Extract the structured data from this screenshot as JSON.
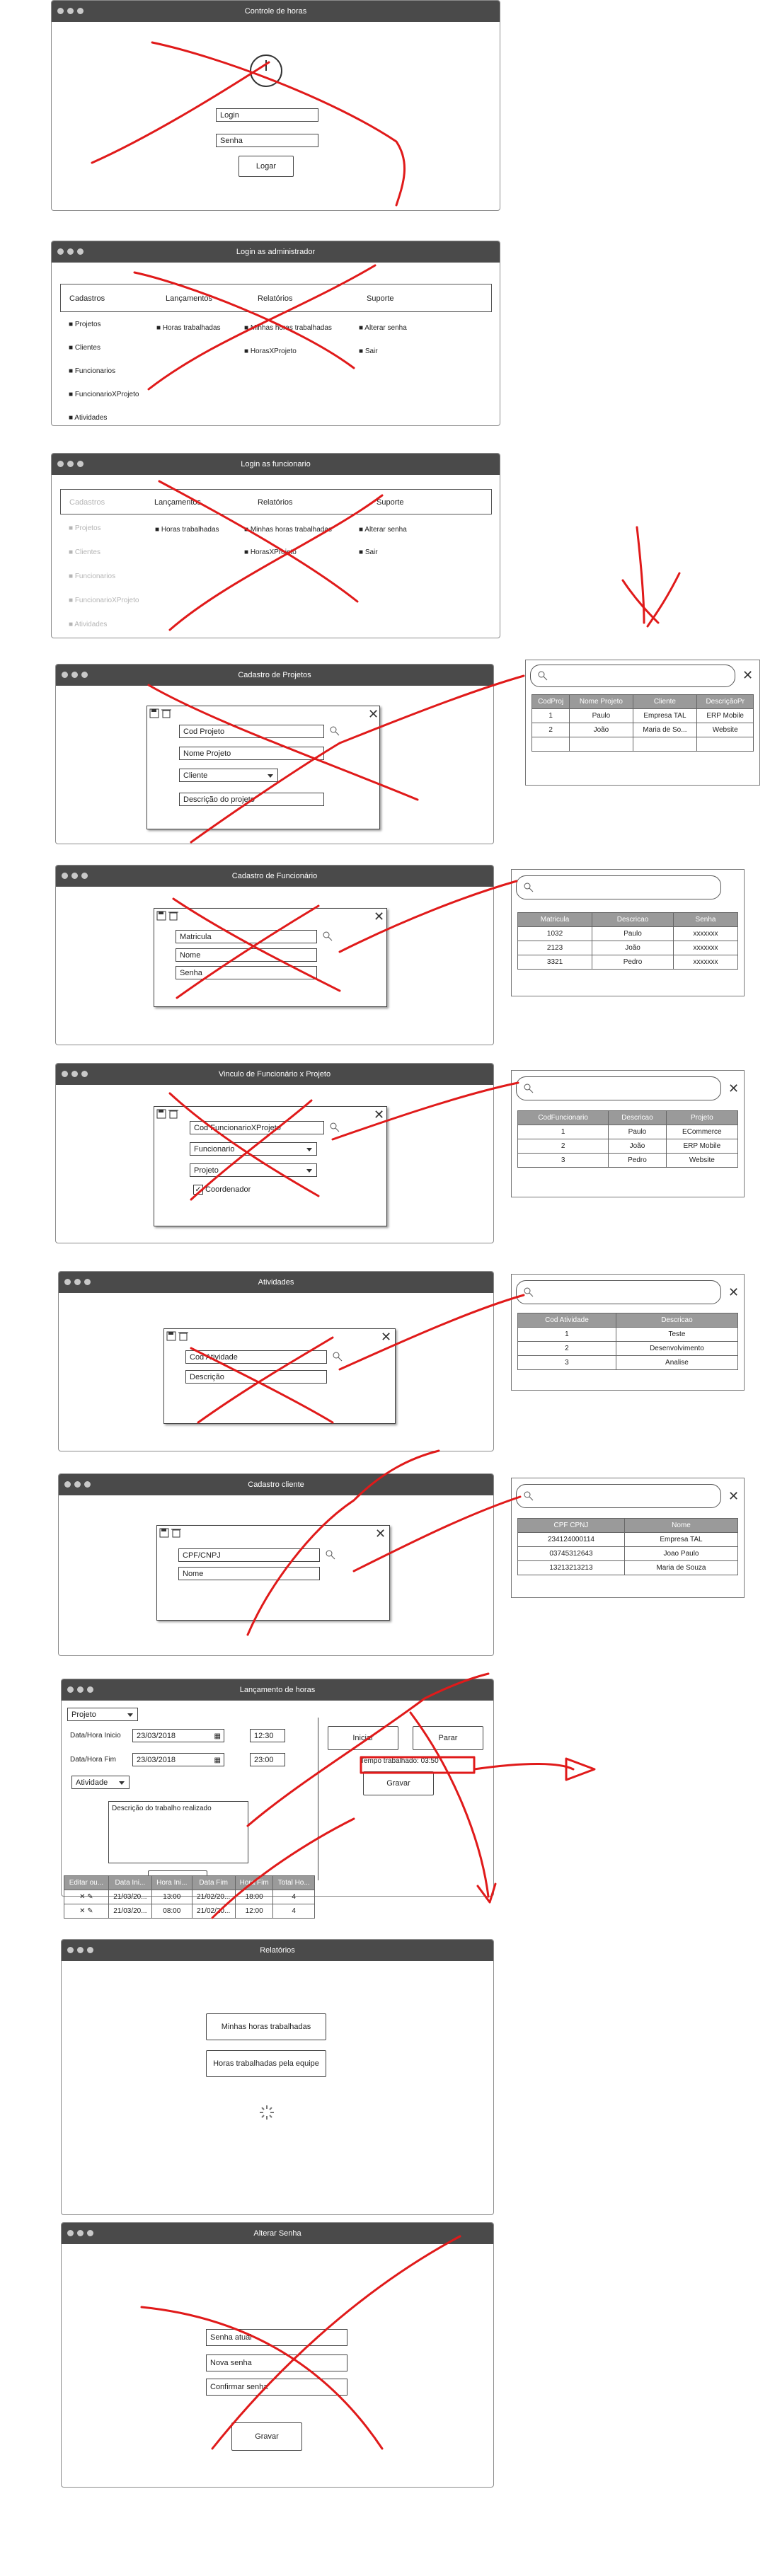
{
  "login": {
    "title": "Controle de horas",
    "login_ph": "Login",
    "senha_ph": "Senha",
    "logar": "Logar"
  },
  "admin": {
    "title": "Login as administrador",
    "menu": [
      "Cadastros",
      "Lançamentos",
      "Relatórios",
      "Suporte"
    ],
    "cadastros": [
      "Projetos",
      "Clientes",
      "Funcionarios",
      "FuncionarioXProjeto",
      "Atividades"
    ],
    "lancamentos": [
      "Horas trabalhadas"
    ],
    "relatorios": [
      "Minhas horas trabalhadas",
      "HorasXProjeto"
    ],
    "suporte": [
      "Alterar senha",
      "Sair"
    ]
  },
  "func": {
    "title": "Login as funcionario",
    "menu": [
      "Cadastros",
      "Lançamentos",
      "Relatórios",
      "Suporte"
    ],
    "cadastros": [
      "Projetos",
      "Clientes",
      "Funcionarios",
      "FuncionarioXProjeto",
      "Atividades"
    ],
    "lancamentos": [
      "Horas trabalhadas"
    ],
    "relatorios": [
      "Minhas horas trabalhadas",
      "HorasXProjeto"
    ],
    "suporte": [
      "Alterar senha",
      "Sair"
    ]
  },
  "projetos": {
    "title": "Cadastro de Projetos",
    "cod": "Cod Projeto",
    "nome": "Nome Projeto",
    "cliente": "Cliente",
    "descricao": "Descrição do projeto",
    "table": {
      "headers": [
        "CodProj",
        "Nome Projeto",
        "Cliente",
        "DescriçãoPr"
      ],
      "rows": [
        [
          "1",
          "Paulo",
          "Empresa TAL",
          "ERP Mobile"
        ],
        [
          "2",
          "João",
          "Maria de So...",
          "Website"
        ],
        [
          "",
          "",
          "",
          ""
        ]
      ]
    }
  },
  "funcionario": {
    "title": "Cadastro de Funcionário",
    "matricula": "Matricula",
    "nome": "Nome",
    "senha": "Senha",
    "table": {
      "headers": [
        "Matricula",
        "Descricao",
        "Senha"
      ],
      "rows": [
        [
          "1032",
          "Paulo",
          "xxxxxxx"
        ],
        [
          "2123",
          "João",
          "xxxxxxx"
        ],
        [
          "3321",
          "Pedro",
          "xxxxxxx"
        ]
      ]
    }
  },
  "vinculo": {
    "title": "Vinculo de Funcionário x Projeto",
    "cod": "Cod FuncionarioXProjeto",
    "funcionario": "Funcionario",
    "projeto": "Projeto",
    "coordenador": "Coordenador",
    "table": {
      "headers": [
        "CodFuncionario",
        "Descricao",
        "Projeto"
      ],
      "rows": [
        [
          "1",
          "Paulo",
          "ECommerce"
        ],
        [
          "2",
          "João",
          "ERP Mobile"
        ],
        [
          "3",
          "Pedro",
          "Website"
        ]
      ]
    }
  },
  "atividades": {
    "title": "Atividades",
    "cod": "Cod Atividade",
    "descricao": "Descrição",
    "table": {
      "headers": [
        "Cod Atividade",
        "Descricao"
      ],
      "rows": [
        [
          "1",
          "Teste"
        ],
        [
          "2",
          "Desenvolvimento"
        ],
        [
          "3",
          "Analise"
        ]
      ]
    }
  },
  "cliente": {
    "title": "Cadastro cliente",
    "cpf": "CPF/CNPJ",
    "nome": "Nome",
    "table": {
      "headers": [
        "CPF CPNJ",
        "Nome"
      ],
      "rows": [
        [
          "234124000114",
          "Empresa TAL"
        ],
        [
          "03745312643",
          "Joao Paulo"
        ],
        [
          "13213213213",
          "Maria de Souza"
        ]
      ]
    }
  },
  "lancamento": {
    "title": "Lançamento de horas",
    "projeto": "Projeto",
    "inicio_label": "Data/Hora Inicio",
    "inicio_date": "23/03/2018",
    "inicio_time": "12:30",
    "fim_label": "Data/Hora Fim",
    "fim_date": "23/03/2018",
    "fim_time": "23:00",
    "atividade": "Atividade",
    "descricao": "Descrição do trabalho realizado",
    "gravar": "Gravar",
    "iniciar": "Iniciar",
    "parar": "Parar",
    "tempo": "Tempo trabalhado: 03:50",
    "gravar2": "Gravar",
    "table": {
      "headers": [
        "Editar ou...",
        "Data Ini...",
        "Hora Ini...",
        "Data Fim",
        "Hora Fim",
        "Total Ho..."
      ],
      "rows": [
        [
          "",
          "21/03/20...",
          "13:00",
          "21/02/20...",
          "18:00",
          "4"
        ],
        [
          "",
          "21/03/20...",
          "08:00",
          "21/02/20...",
          "12:00",
          "4"
        ]
      ]
    }
  },
  "relatorios": {
    "title": "Relatórios",
    "minhas": "Minhas horas trabalhadas",
    "equipe": "Horas trabalhadas pela equipe"
  },
  "senha": {
    "title": "Alterar Senha",
    "atual": "Senha atual",
    "nova": "Nova senha",
    "confirmar": "Confirmar senha",
    "gravar": "Gravar"
  },
  "colors": {
    "titlebar": "#4a4a4a",
    "header": "#9a9a9a",
    "annotation": "#e01a1a"
  }
}
